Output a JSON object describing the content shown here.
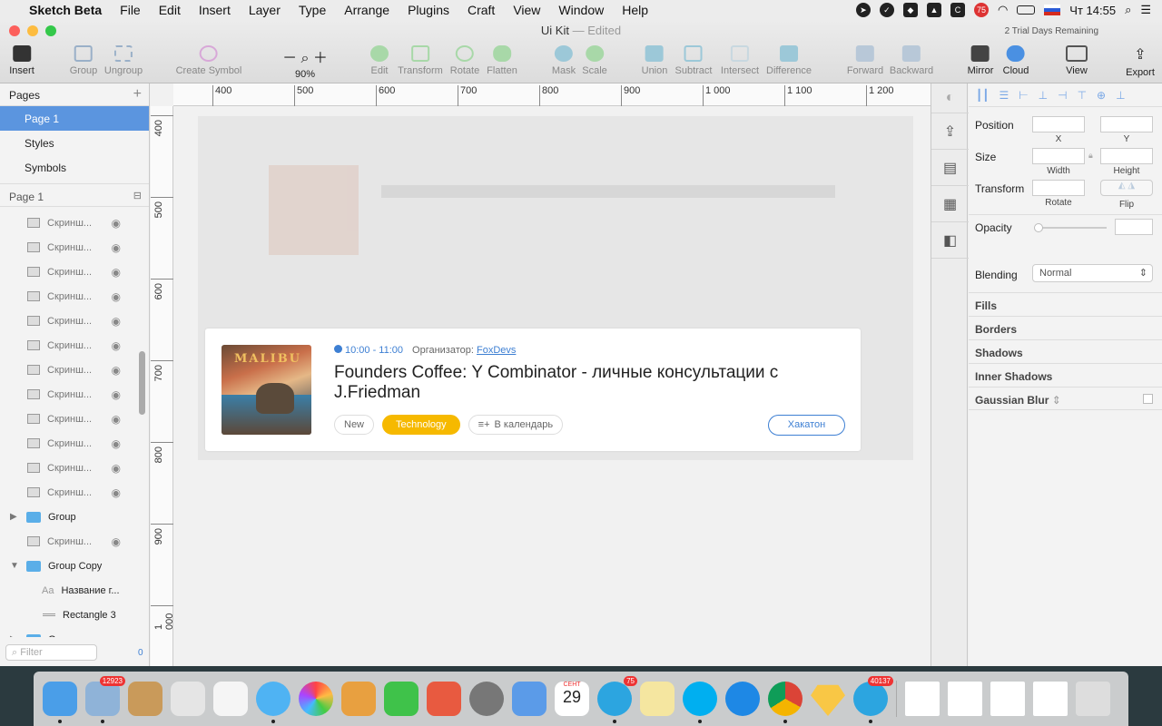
{
  "menubar": {
    "app": "Sketch Beta",
    "items": [
      "File",
      "Edit",
      "Insert",
      "Layer",
      "Type",
      "Arrange",
      "Plugins",
      "Craft",
      "View",
      "Window",
      "Help"
    ],
    "clock": "Чт 14:55",
    "badge": "75"
  },
  "window": {
    "title": "Ui Kit",
    "status": "— Edited",
    "trial": "2 Trial Days Remaining"
  },
  "toolbar": {
    "insert": "Insert",
    "group": "Group",
    "ungroup": "Ungroup",
    "create_symbol": "Create Symbol",
    "zoom": "90%",
    "edit": "Edit",
    "transform": "Transform",
    "rotate": "Rotate",
    "flatten": "Flatten",
    "mask": "Mask",
    "scale": "Scale",
    "union": "Union",
    "subtract": "Subtract",
    "intersect": "Intersect",
    "difference": "Difference",
    "forward": "Forward",
    "backward": "Backward",
    "mirror": "Mirror",
    "cloud": "Cloud",
    "view": "View",
    "export": "Export"
  },
  "pages": {
    "header": "Pages",
    "items": [
      "Page 1",
      "Styles",
      "Symbols"
    ],
    "current": "Page 1"
  },
  "layers": {
    "items": [
      {
        "name": "Скринш...",
        "kind": "image"
      },
      {
        "name": "Скринш...",
        "kind": "image"
      },
      {
        "name": "Скринш...",
        "kind": "image"
      },
      {
        "name": "Скринш...",
        "kind": "image"
      },
      {
        "name": "Скринш...",
        "kind": "image"
      },
      {
        "name": "Скринш...",
        "kind": "image"
      },
      {
        "name": "Скринш...",
        "kind": "image"
      },
      {
        "name": "Скринш...",
        "kind": "image"
      },
      {
        "name": "Скринш...",
        "kind": "image"
      },
      {
        "name": "Скринш...",
        "kind": "image"
      },
      {
        "name": "Скринш...",
        "kind": "image"
      },
      {
        "name": "Скринш...",
        "kind": "image"
      },
      {
        "name": "Group",
        "kind": "group"
      },
      {
        "name": "Скринш...",
        "kind": "image"
      },
      {
        "name": "Group Copy",
        "kind": "group-open"
      },
      {
        "name": "Название г...",
        "kind": "text"
      },
      {
        "name": "Rectangle 3",
        "kind": "rect"
      },
      {
        "name": "Group",
        "kind": "group"
      }
    ],
    "filter_placeholder": "Filter",
    "filter_count": "0"
  },
  "rulers": {
    "h": [
      "400",
      "500",
      "600",
      "700",
      "800",
      "900",
      "1 000",
      "1 100",
      "1 200"
    ],
    "v": [
      "400",
      "500",
      "600",
      "700",
      "800",
      "900",
      "1 000"
    ]
  },
  "card": {
    "time": "10:00 - 11:00",
    "organizer_label": "Организатор:",
    "organizer": "FoxDevs",
    "title": "Founders Coffee: Y Combinator - личные консультации с J.Friedman",
    "tag_new": "New",
    "tag_tech": "Technology",
    "calendar": "В календарь",
    "action": "Хакатон",
    "cover_text": "MALIBU"
  },
  "inspector": {
    "position": "Position",
    "x": "X",
    "y": "Y",
    "size": "Size",
    "width": "Width",
    "height": "Height",
    "transform": "Transform",
    "rotate": "Rotate",
    "flip": "Flip",
    "opacity": "Opacity",
    "blending": "Blending",
    "blending_value": "Normal",
    "fills": "Fills",
    "borders": "Borders",
    "shadows": "Shadows",
    "inner_shadows": "Inner Shadows",
    "gaussian_blur": "Gaussian Blur"
  },
  "dock": {
    "mail_badge": "12923",
    "telegram_badge": "75",
    "telegram2_badge": "40137",
    "calendar_month": "СЕНТ",
    "calendar_day": "29"
  },
  "colors": {
    "selection": "#5b95df",
    "accent": "#3d7fd3",
    "tag_tech": "#f6b900"
  }
}
